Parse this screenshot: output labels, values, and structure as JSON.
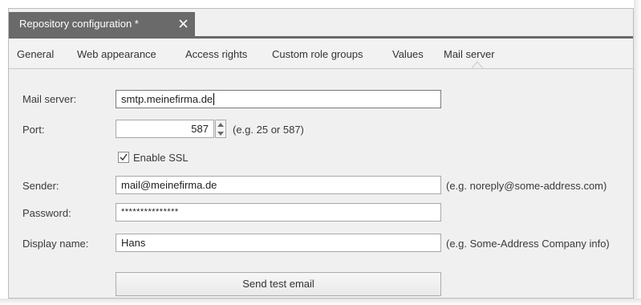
{
  "document_tab": {
    "title": "Repository configuration *",
    "close_glyph": "✕"
  },
  "tabs": [
    {
      "label": "General",
      "active": false
    },
    {
      "label": "Web appearance",
      "active": false
    },
    {
      "label": "Access rights",
      "active": false
    },
    {
      "label": "Custom role groups",
      "active": false
    },
    {
      "label": "Values",
      "active": false
    },
    {
      "label": "Mail server",
      "active": true
    }
  ],
  "form": {
    "mail_server": {
      "label": "Mail server:",
      "value": "smtp.meinefirma.de"
    },
    "port": {
      "label": "Port:",
      "value": "587",
      "hint": "(e.g. 25 or 587)"
    },
    "enable_ssl": {
      "label": "Enable SSL",
      "checked": true
    },
    "sender": {
      "label": "Sender:",
      "value": "mail@meinefirma.de",
      "hint": "(e.g. noreply@some-address.com)"
    },
    "password": {
      "label": "Password:",
      "value": "***************"
    },
    "display_name": {
      "label": "Display name:",
      "value": "Hans",
      "hint": "(e.g. Some-Address Company info)"
    },
    "send_test_email": {
      "label": "Send test email"
    }
  },
  "icons": {
    "close": "close-icon",
    "spin_up": "chevron-up-icon",
    "spin_down": "chevron-down-icon",
    "check": "checkmark-icon"
  },
  "colors": {
    "doc_tab_bg": "#6a6a6a",
    "panel_bg": "#f0f0f0",
    "field_border": "#a8a8a8"
  }
}
